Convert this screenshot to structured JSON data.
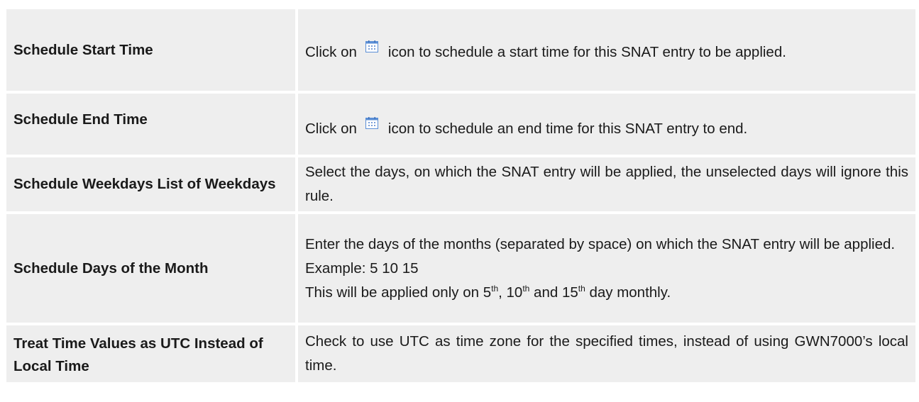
{
  "rows": [
    {
      "name": "Schedule Start Time",
      "desc_before_icon": "Click on",
      "icon": "calendar-icon",
      "desc_after_icon": "icon to schedule a start time for this SNAT entry to be applied."
    },
    {
      "name": "Schedule End Time",
      "desc_before_icon": "Click on",
      "icon": "calendar-icon",
      "desc_after_icon": "icon to schedule an end time for this SNAT entry to end."
    },
    {
      "name": "Schedule Weekdays List of Weekdays",
      "desc": "Select the days, on which the SNAT entry will be applied, the unselected days will ignore this rule."
    },
    {
      "name": "Schedule Days of the Month",
      "desc_line1": "Enter the days of the months (separated by space) on which the SNAT entry will be applied.",
      "desc_line2": "Example: 5 10 15",
      "desc_line3_a": "This will be applied only on 5",
      "desc_line3_sup1": "th",
      "desc_line3_b": ", 10",
      "desc_line3_sup2": "th",
      "desc_line3_c": " and 15",
      "desc_line3_sup3": "th",
      "desc_line3_d": " day monthly."
    },
    {
      "name": "Treat Time Values as UTC Instead of Local Time",
      "desc": "Check to use UTC as time zone for the specified times, instead of using GWN7000’s local time."
    }
  ],
  "colors": {
    "cell_background": "#eeeeee",
    "text": "#1a1a1a",
    "icon_blue": "#5b8fd6"
  }
}
